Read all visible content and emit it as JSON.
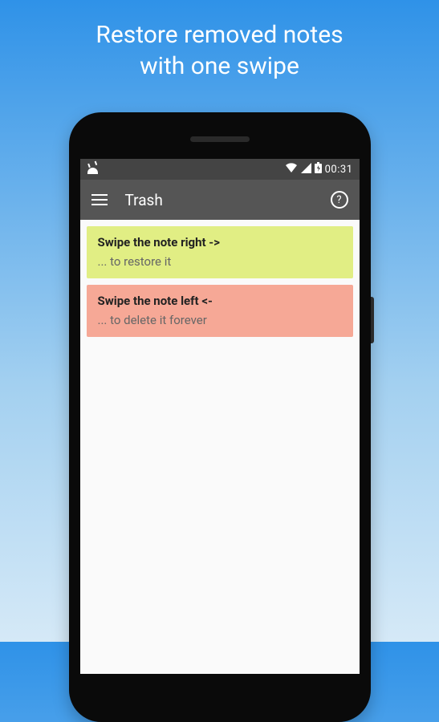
{
  "promo": {
    "line1": "Restore removed notes",
    "line2": "with one swipe"
  },
  "status_bar": {
    "time": "00:31"
  },
  "app_bar": {
    "title": "Trash",
    "help_glyph": "?"
  },
  "notes": [
    {
      "title": "Swipe the note right ->",
      "body": "... to restore it",
      "color": "yellow"
    },
    {
      "title": "Swipe the note left <-",
      "body": "... to delete it forever",
      "color": "salmon"
    }
  ]
}
